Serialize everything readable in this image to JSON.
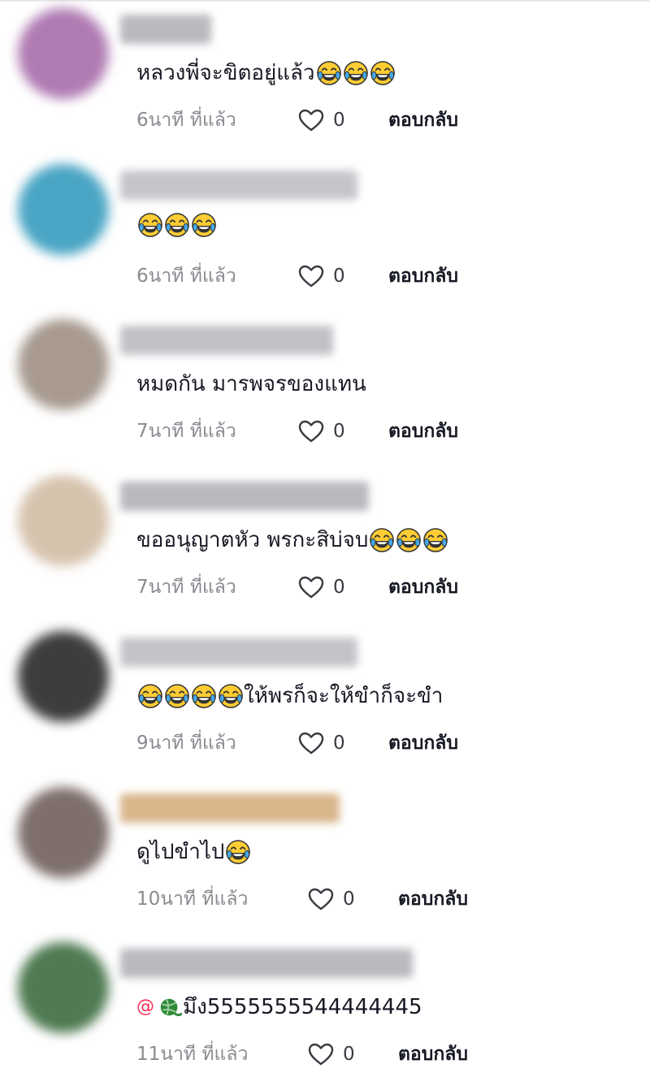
{
  "colors": {
    "accent": "#fe2c55",
    "meta_gray": "#8a8b91"
  },
  "comments": [
    {
      "avatar_color": "#b07bb3",
      "segments": [
        {
          "type": "text",
          "value": "หลวงพี่จะขิตอยู่แล้ว"
        },
        {
          "type": "emoji",
          "icon": "tears-of-joy-emoji"
        },
        {
          "type": "emoji",
          "icon": "tears-of-joy-emoji"
        },
        {
          "type": "emoji",
          "icon": "tears-of-joy-emoji"
        }
      ],
      "time": "6นาที ที่แล้ว",
      "likes": "0",
      "reply_label": "ตอบกลับ"
    },
    {
      "avatar_color": "#4aa5c4",
      "segments": [
        {
          "type": "emoji",
          "icon": "tears-of-joy-emoji"
        },
        {
          "type": "emoji",
          "icon": "tears-of-joy-emoji"
        },
        {
          "type": "emoji",
          "icon": "tears-of-joy-emoji"
        }
      ],
      "time": "6นาที ที่แล้ว",
      "likes": "0",
      "reply_label": "ตอบกลับ"
    },
    {
      "avatar_color": "#a89a8f",
      "segments": [
        {
          "type": "text",
          "value": "หมดกัน มารพจรของแทน"
        }
      ],
      "time": "7นาที ที่แล้ว",
      "likes": "0",
      "reply_label": "ตอบกลับ"
    },
    {
      "avatar_color": "#d6c3ae",
      "segments": [
        {
          "type": "text",
          "value": "ขออนุญาตหัว พรกะสิบ่จบ"
        },
        {
          "type": "emoji",
          "icon": "tears-of-joy-emoji"
        },
        {
          "type": "emoji",
          "icon": "tears-of-joy-emoji"
        },
        {
          "type": "emoji",
          "icon": "tears-of-joy-emoji"
        }
      ],
      "time": "7นาที ที่แล้ว",
      "likes": "0",
      "reply_label": "ตอบกลับ"
    },
    {
      "avatar_color": "#3d3d3f",
      "segments": [
        {
          "type": "emoji",
          "icon": "tears-of-joy-emoji"
        },
        {
          "type": "emoji",
          "icon": "tears-of-joy-emoji"
        },
        {
          "type": "emoji",
          "icon": "tears-of-joy-emoji"
        },
        {
          "type": "emoji",
          "icon": "tears-of-joy-emoji"
        },
        {
          "type": "text",
          "value": "ให้พรก็จะให้ขำก็จะขำ"
        }
      ],
      "time": "9นาที ที่แล้ว",
      "likes": "0",
      "reply_label": "ตอบกลับ"
    },
    {
      "avatar_color": "#7e6f6c",
      "segments": [
        {
          "type": "text",
          "value": "ดูไปขำไป"
        },
        {
          "type": "emoji",
          "icon": "tears-of-joy-emoji"
        }
      ],
      "time": "10นาที ที่แล้ว",
      "likes": "0",
      "reply_label": "ตอบกลับ"
    },
    {
      "avatar_color": "#4f7a52",
      "segments": [
        {
          "type": "mention",
          "value": "@"
        },
        {
          "type": "emoji",
          "icon": "green-ball-emoji"
        },
        {
          "type": "text",
          "value": " มึง5555555544444445"
        }
      ],
      "time": "11นาที ที่แล้ว",
      "likes": "0",
      "reply_label": "ตอบกลับ"
    }
  ]
}
